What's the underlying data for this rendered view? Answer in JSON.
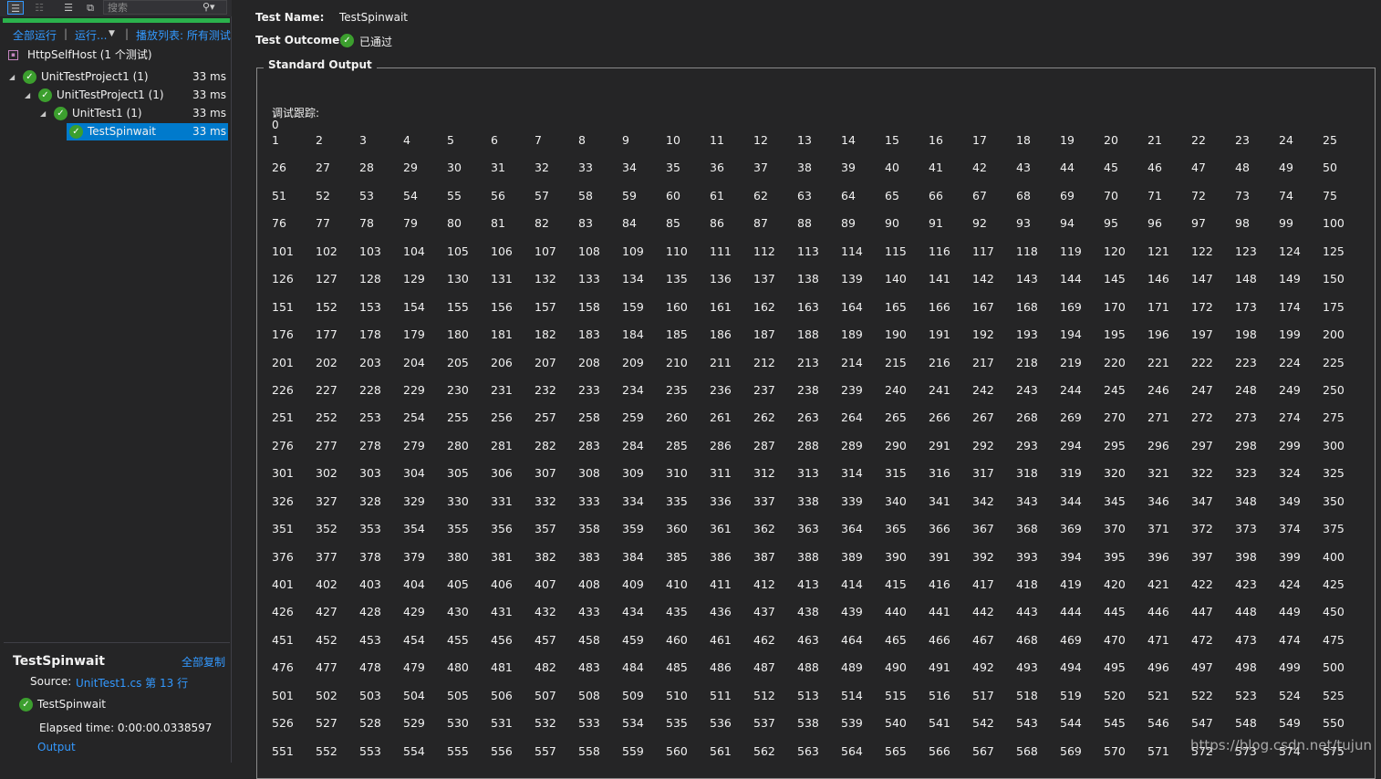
{
  "explorer": {
    "search_placeholder": "搜索",
    "actions": {
      "run_all": "全部运行",
      "run_menu": "运行...",
      "playlist": "播放列表: 所有测试"
    },
    "tree": [
      {
        "label": "HttpSelfHost (1 个测试)",
        "time": ""
      },
      {
        "label": "UnitTestProject1 (1)",
        "time": "33 ms"
      },
      {
        "label": "UnitTestProject1 (1)",
        "time": "33 ms"
      },
      {
        "label": "UnitTest1 (1)",
        "time": "33 ms"
      },
      {
        "label": "TestSpinwait",
        "time": "33 ms"
      }
    ],
    "details": {
      "title": "TestSpinwait",
      "copy_all": "全部复制",
      "source_label": "Source:",
      "source_link": "UnitTest1.cs 第 13 行",
      "test_name": "TestSpinwait",
      "elapsed": "Elapsed time: 0:00:00.0338597",
      "output_link": "Output"
    }
  },
  "main": {
    "test_name_label": "Test Name:",
    "test_name_value": "TestSpinwait",
    "outcome_label": "Test Outcome:",
    "outcome_value": "已通过",
    "std_title": "Standard Output",
    "debug_label": "调试跟踪:",
    "first_line": "0",
    "numbers_from": 1,
    "numbers_to": 575
  },
  "watermark": "https://blog.csdn.net/tujun",
  "colors": {
    "accent": "#007acc",
    "link": "#3399ff",
    "pass": "#3c9f2e",
    "progress": "#2bb24c"
  }
}
